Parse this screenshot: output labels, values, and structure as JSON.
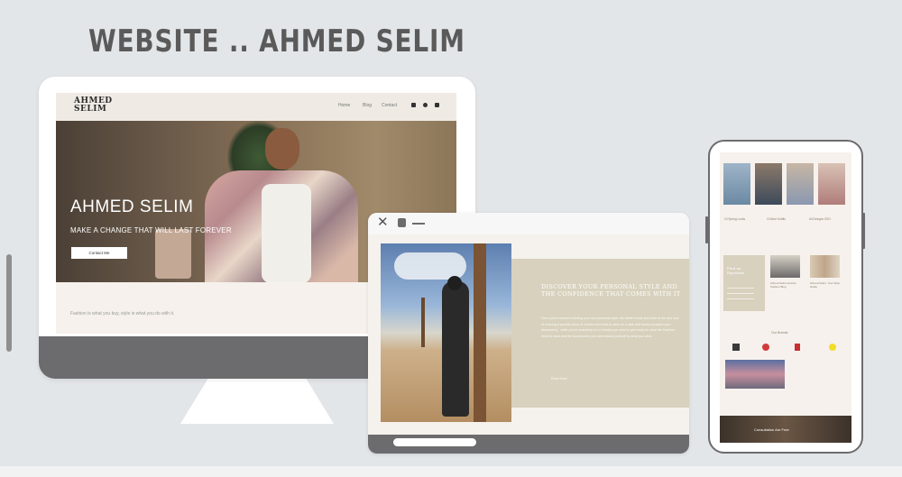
{
  "heading": "WEBSITE .. AHMED SELIM",
  "desktop": {
    "logo_line1": "AHMED",
    "logo_line2": "SELIM",
    "nav": [
      "Home",
      "Blog",
      "Contact"
    ],
    "hero_title": "AHMED SELIM",
    "hero_subtitle": "MAKE A CHANGE THAT WILL LAST FOREVER",
    "hero_button": "Contact Me",
    "footer_text": "Fashion is what you buy, style is what you do with it."
  },
  "tablet": {
    "close_glyph": "✕",
    "panel_heading": "DISCOVER YOUR PERSONAL STYLE AND THE CONFIDENCE THAT COMES WITH IT",
    "panel_body": "Here you're arrived to finding your own personal style, the latest trends and what to the and how of wearing a specific piece of clothes and what to wear for a date and lovely occasion your discovering - while you're searching on or holiday you need to get ready for what the Fashion trend to wear and the Accessories you need about yourself by what you wear.",
    "panel_button": "Read More"
  },
  "phone": {
    "captions": [
      "10 Spring Looks",
      "10 Best Outfits",
      "All Designs 2021"
    ],
    "card_title": "Find an Expertise",
    "blog_captions": [
      "Ahmed Selim and the Fashion Blog",
      "Ahmed Selim: Your Style Guide"
    ],
    "section_title": "Our Brands",
    "footer_text": "Consultation Are Free"
  }
}
